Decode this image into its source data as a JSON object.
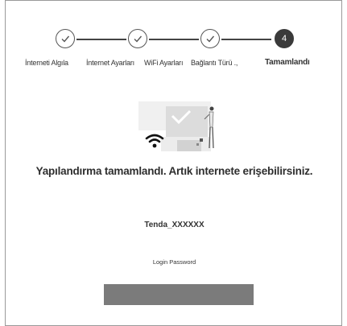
{
  "stepper": {
    "steps": [
      {
        "label": "İnterneti Algıla",
        "state": "done"
      },
      {
        "label": "İnternet Ayarları",
        "state": "done"
      },
      {
        "label": "WiFi Ayarları",
        "state": "done"
      },
      {
        "label": "Bağlantı Türü .,",
        "state": "done"
      },
      {
        "label": "Tamamlandı",
        "state": "active",
        "number": "4"
      }
    ]
  },
  "illustration": {
    "icon": "wifi-icon",
    "accent": "#d6d6d6"
  },
  "main": {
    "headline": "Yapılandırma tamamlandı. Artık internete erişebilirsiniz.",
    "ssid": "Tenda_XXXXXX",
    "password_label": "Login Password"
  },
  "colors": {
    "active_step": "#3a3a3a",
    "password_bar": "#7b7b7b"
  }
}
